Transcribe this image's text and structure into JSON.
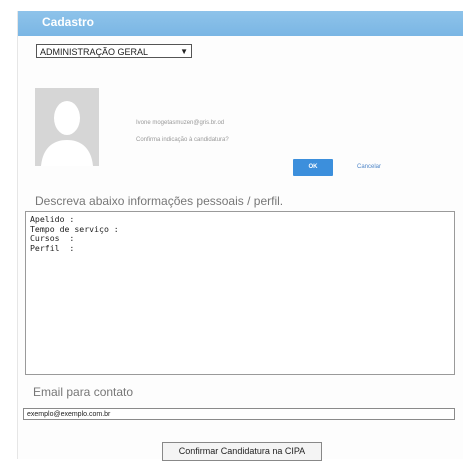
{
  "header": {
    "title": "Cadastro"
  },
  "department_select": {
    "selected": "ADMINISTRAÇÃO GERAL"
  },
  "profile": {
    "info_line": "Ivone mogetasmuzen@gris.br.od",
    "confirm_line": "Confirma indicação à candidatura?",
    "ok_label": "OK",
    "cancel_label": "Cancelar"
  },
  "description": {
    "label": "Descreva abaixo informações pessoais / perfil.",
    "lines": [
      "Apelido :",
      "Tempo de serviço :",
      "Cursos  :",
      "Perfil  :"
    ]
  },
  "email": {
    "label": "Email para contato",
    "value": "exemplo@exemplo.com.br"
  },
  "confirm_button": {
    "label": "Confirmar Candidatura na CIPA"
  },
  "colors": {
    "header": "#7ab6e4",
    "primary_button": "#3c8fdc"
  }
}
